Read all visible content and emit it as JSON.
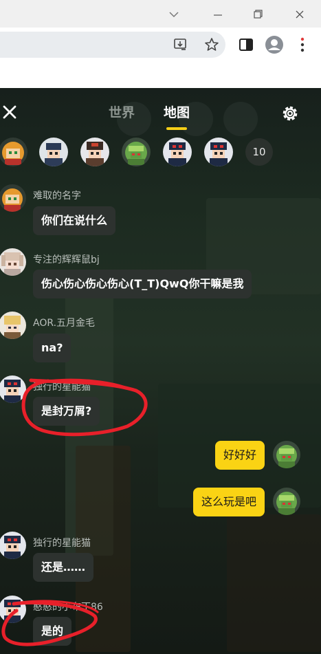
{
  "browser": {
    "icons": [
      "chevron-down-icon",
      "minimize-icon",
      "restore-icon",
      "close-icon",
      "install-icon",
      "bookmark-star-icon",
      "side-panel-icon",
      "profile-icon",
      "menu-dots-icon"
    ]
  },
  "chat": {
    "tabs": [
      {
        "label": "世界",
        "active": false
      },
      {
        "label": "地图",
        "active": true
      }
    ],
    "member_count": "10",
    "messages": [
      {
        "sender": "难取的名字",
        "text": "你们在说什么",
        "mine": false
      },
      {
        "sender": "专注的辉辉鼠bj",
        "text": "伤心伤心伤心伤心(T_T)QwQ你干嘛是我",
        "mine": false
      },
      {
        "sender": "AOR.五月金毛",
        "text": "na?",
        "mine": false
      },
      {
        "sender": "独行的星能猫",
        "text": "是封万屑?",
        "mine": false
      },
      {
        "sender": "",
        "text": "好好好",
        "mine": true
      },
      {
        "sender": "",
        "text": "这么玩是吧",
        "mine": true
      },
      {
        "sender": "独行的星能猫",
        "text": "还是……",
        "mine": false
      },
      {
        "sender": "憨憨的小布丁86",
        "text": "是的",
        "mine": false
      }
    ]
  },
  "colors": {
    "accent": "#fad314",
    "bubble_other": "#2d322f",
    "annotation_red": "#e8202a"
  }
}
